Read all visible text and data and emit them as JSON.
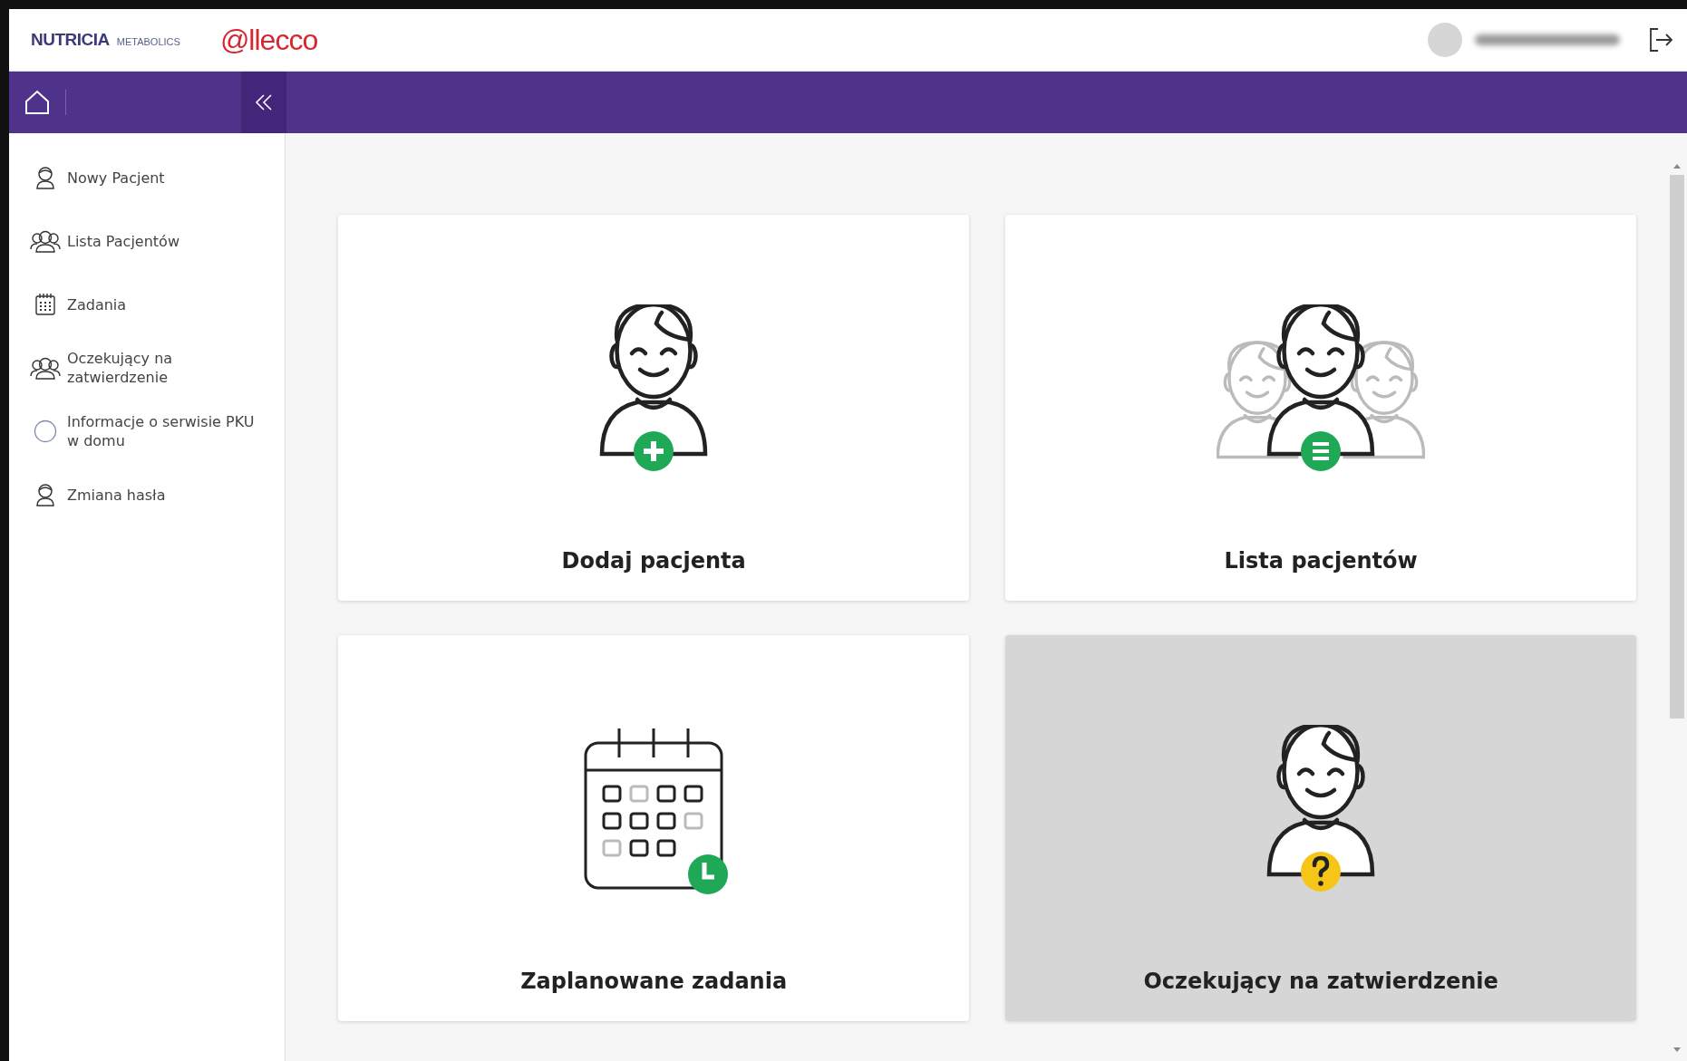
{
  "header": {
    "brand_logo": {
      "name": "NUTRICIA",
      "suffix": "METABOLICS"
    },
    "partner_logo": "@llecco"
  },
  "sidebar": {
    "items": [
      {
        "label": "Nowy Pacjent",
        "kind": "person"
      },
      {
        "label": "Lista Pacjentów",
        "kind": "group"
      },
      {
        "label": "Zadania",
        "kind": "calendar"
      },
      {
        "label": "Oczekujący na zatwierdzenie",
        "kind": "group"
      },
      {
        "label": "Informacje o serwisie PKU w domu",
        "kind": "circle"
      },
      {
        "label": "Zmiana hasła",
        "kind": "person"
      }
    ]
  },
  "cards": [
    {
      "title": "Dodaj pacjenta",
      "kind": "add",
      "highlighted": false
    },
    {
      "title": "Lista pacjentów",
      "kind": "list",
      "highlighted": false
    },
    {
      "title": "Zaplanowane zadania",
      "kind": "calendar",
      "highlighted": false
    },
    {
      "title": "Oczekujący na zatwierdzenie",
      "kind": "pending",
      "highlighted": true
    }
  ]
}
